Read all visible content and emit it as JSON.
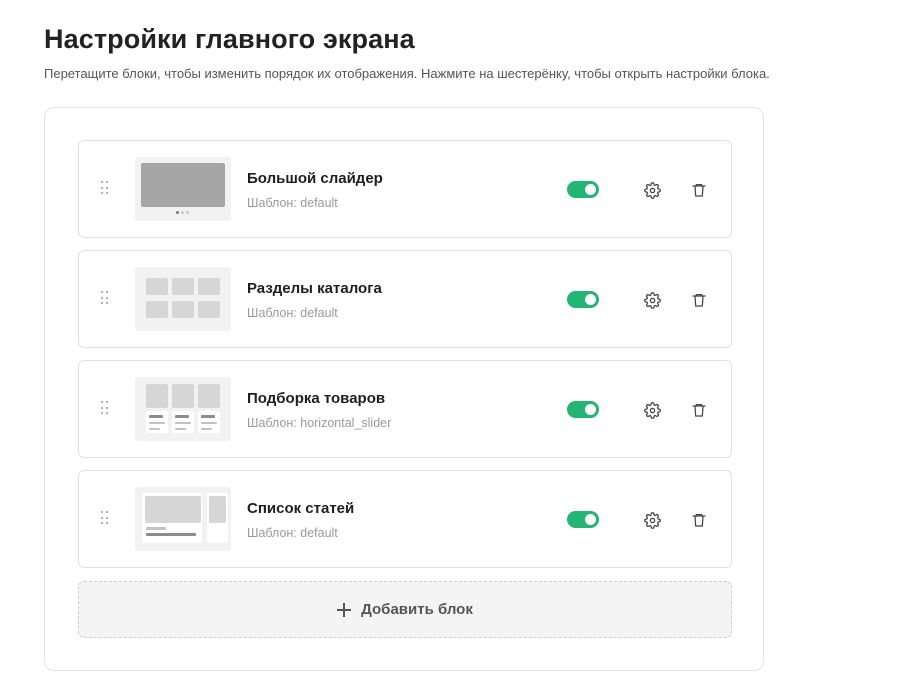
{
  "header": {
    "title": "Настройки главного экрана",
    "subtitle": "Перетащите блоки, чтобы изменить порядок их отображения. Нажмите на шестерёнку, чтобы открыть настройки блока."
  },
  "blocks": [
    {
      "title": "Большой слайдер",
      "template": "Шаблон: default",
      "enabled": true,
      "thumb": "slider-preview-icon"
    },
    {
      "title": "Разделы каталога",
      "template": "Шаблон: default",
      "enabled": true,
      "thumb": "catalog-grid-preview-icon"
    },
    {
      "title": "Подборка товаров",
      "template": "Шаблон: horizontal_slider",
      "enabled": true,
      "thumb": "products-preview-icon"
    },
    {
      "title": "Список статей",
      "template": "Шаблон: default",
      "enabled": true,
      "thumb": "articles-preview-icon"
    }
  ],
  "add_block": {
    "label": "Добавить блок"
  },
  "colors": {
    "toggle_on": "#22b573",
    "text_muted": "#9a9a9a",
    "icon": "#444444"
  }
}
